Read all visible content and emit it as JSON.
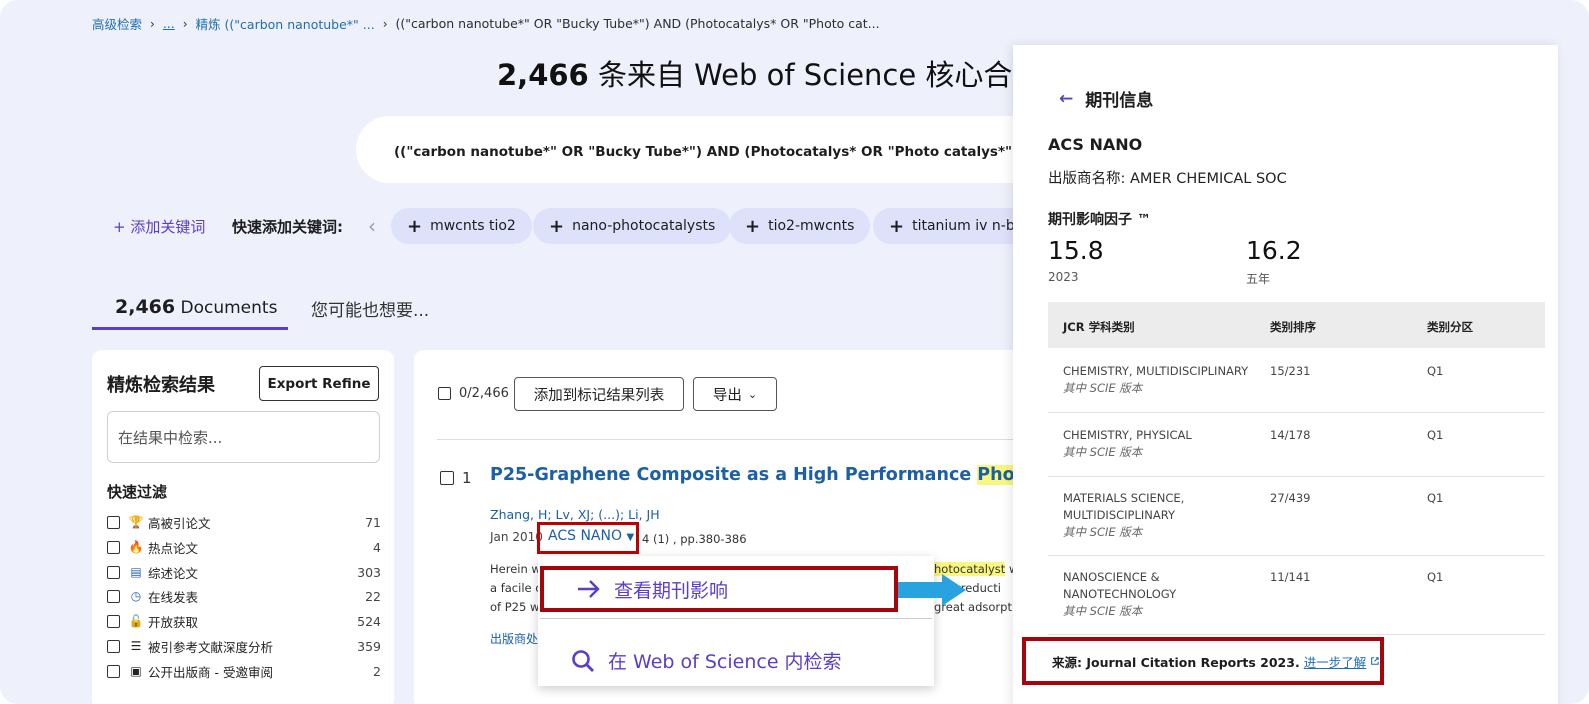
{
  "breadcrumb": {
    "item1": "高级检索",
    "item2": "...",
    "item3": "精炼 ((\"carbon nanotube*\" ...",
    "item4": "((\"carbon nanotube*\" OR \"Bucky Tube*\") AND (Photocatalys* OR \"Photo cat..."
  },
  "headline": {
    "count": "2,466",
    "text": " 条来自 Web of Science 核心合集的"
  },
  "query": "((\"carbon nanotube*\" OR \"Bucky Tube*\") AND (Photocatalys* OR \"Photo catalys*\")) (主题)",
  "keywords": {
    "add_label": "+ 添加关键词",
    "quick_label": "快速添加关键词:",
    "prev_icon": "chevron-left",
    "chips": [
      "mwcnts tio2",
      "nano-photocatalysts",
      "tio2-mwcnts",
      "titanium iv n-bu"
    ]
  },
  "tabs": {
    "documents_count": "2,466",
    "documents_label": " Documents",
    "suggest_label": "您可能也想要..."
  },
  "refine": {
    "title": "精炼检索结果",
    "export_label": "Export Refine",
    "search_placeholder": "在结果中检索...",
    "quick_filter_title": "快速过滤",
    "filters": [
      {
        "icon": "trophy-icon",
        "label": "高被引论文",
        "count": "71"
      },
      {
        "icon": "fire-icon",
        "label": "热点论文",
        "count": "4"
      },
      {
        "icon": "document-icon",
        "label": "综述论文",
        "count": "303"
      },
      {
        "icon": "clock-icon",
        "label": "在线发表",
        "count": "22"
      },
      {
        "icon": "lock-open-icon",
        "label": "开放获取",
        "count": "524"
      },
      {
        "icon": "list-star-icon",
        "label": "被引参考文献深度分析",
        "count": "359"
      },
      {
        "icon": "comment-icon",
        "label": "公开出版商 - 受邀审阅",
        "count": "2"
      }
    ]
  },
  "results": {
    "select_label": "0/2,466",
    "add_marked_label": "添加到标记结果列表",
    "export_label": "导出",
    "record": {
      "number": "1",
      "title_prefix": "P25-Graphene Composite as a High Performance ",
      "title_highlight": "Photocatalyst",
      "authors": "Zhang, H; Lv, XJ; (...); Li, JH",
      "date": "Jan 2010",
      "journal": "ACS NANO",
      "volume": "4 (1) , pp.380-386",
      "abstract_lines": [
        "Herein w",
        "a facile c",
        "of P25 w"
      ],
      "abstract_right_highlight": "hotocatalyst",
      "abstract_right_lines": [
        " w",
        "e reducti",
        "great adsorptiv"
      ],
      "publisher_link": "出版商处"
    },
    "dropdown": {
      "item1_label": "查看期刊影响",
      "item2_label": "在 Web of Science 内检索"
    }
  },
  "journal_panel": {
    "title": "期刊信息",
    "journal_name": "ACS NANO",
    "publisher": "出版商名称: AMER CHEMICAL SOC",
    "if_label": "期刊影响因子 ™",
    "if_value": "15.8",
    "if_year": "2023",
    "if5_value": "16.2",
    "if5_label": "五年",
    "table_headers": [
      "JCR 学科类别",
      "类别排序",
      "类别分区"
    ],
    "table_rows": [
      {
        "category": [
          "CHEMISTRY, MULTIDISCIPLINARY"
        ],
        "edition": "其中 SCIE 版本",
        "rank": "15/231",
        "quartile": "Q1"
      },
      {
        "category": [
          "CHEMISTRY, PHYSICAL"
        ],
        "edition": "其中 SCIE 版本",
        "rank": "14/178",
        "quartile": "Q1"
      },
      {
        "category": [
          "MATERIALS SCIENCE,",
          "MULTIDISCIPLINARY"
        ],
        "edition": "其中 SCIE 版本",
        "rank": "27/439",
        "quartile": "Q1"
      },
      {
        "category": [
          "NANOSCIENCE &",
          "NANOTECHNOLOGY"
        ],
        "edition": "其中 SCIE 版本",
        "rank": "11/141",
        "quartile": "Q1"
      }
    ],
    "source_label": "来源: Journal Citation Reports  2023.",
    "source_link": "进一步了解"
  },
  "colors": {
    "accent": "#5a3ec8",
    "link": "#1b5fa5",
    "annotation_red": "#a6050c",
    "highlight": "#f9f77d",
    "chip_bg": "#dde1fa"
  }
}
